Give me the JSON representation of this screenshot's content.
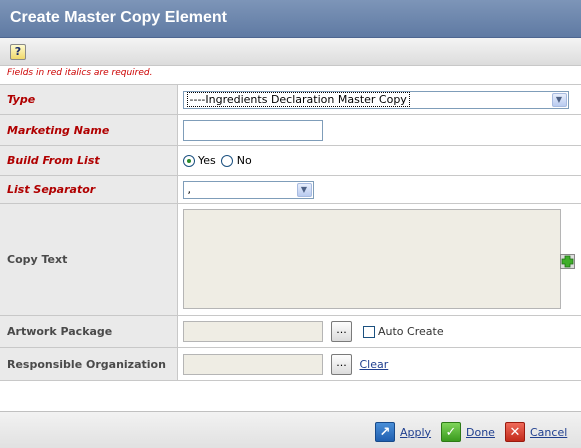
{
  "dialog": {
    "title": "Create Master Copy Element"
  },
  "toolbar": {
    "help_label": "?"
  },
  "required_note": "Fields in red italics are required.",
  "form": {
    "type": {
      "label": "Type",
      "value": "----Ingredients Declaration Master Copy"
    },
    "marketing_name": {
      "label": "Marketing Name",
      "value": ""
    },
    "build_from_list": {
      "label": "Build From List",
      "options": [
        "Yes",
        "No"
      ],
      "selected": "Yes"
    },
    "list_separator": {
      "label": "List Separator",
      "value": ","
    },
    "copy_text": {
      "label": "Copy Text",
      "value": ""
    },
    "artwork_package": {
      "label": "Artwork Package",
      "value": "",
      "browse_label": "...",
      "auto_create_label": "Auto Create",
      "auto_create_checked": false
    },
    "responsible_org": {
      "label": "Responsible Organization",
      "value": "",
      "browse_label": "...",
      "clear_label": "Clear"
    }
  },
  "footer": {
    "apply_label": "Apply",
    "done_label": "Done",
    "cancel_label": "Cancel"
  },
  "colors": {
    "title_bar": "#6f88ae",
    "required_label": "#b00000",
    "link": "#1f3f8f",
    "label_bg": "#eaeaea"
  }
}
